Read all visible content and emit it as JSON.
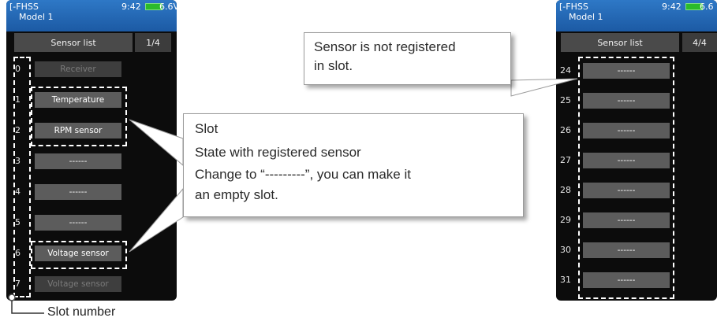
{
  "left_screen": {
    "system_label": "[-FHSS",
    "model_name": "Model 1",
    "time": "9:42",
    "voltage": "6.6V",
    "title": "Sensor list",
    "page": "1/4",
    "rows": [
      {
        "num": "0",
        "label": "Receiver",
        "dim": true
      },
      {
        "num": "1",
        "label": "Temperature",
        "dim": false
      },
      {
        "num": "2",
        "label": "RPM sensor",
        "dim": false
      },
      {
        "num": "3",
        "label": "------",
        "dim": false
      },
      {
        "num": "4",
        "label": "------",
        "dim": false
      },
      {
        "num": "5",
        "label": "------",
        "dim": false
      },
      {
        "num": "6",
        "label": "Voltage sensor",
        "dim": false
      },
      {
        "num": "7",
        "label": "Voltage sensor",
        "dim": true
      }
    ]
  },
  "right_screen": {
    "system_label": "[-FHSS",
    "model_name": "Model 1",
    "time": "9:42",
    "voltage": "6.6",
    "title": "Sensor list",
    "page": "4/4",
    "rows": [
      {
        "num": "24",
        "label": "------"
      },
      {
        "num": "25",
        "label": "------"
      },
      {
        "num": "26",
        "label": "------"
      },
      {
        "num": "27",
        "label": "------"
      },
      {
        "num": "28",
        "label": "------"
      },
      {
        "num": "29",
        "label": "------"
      },
      {
        "num": "30",
        "label": "------"
      },
      {
        "num": "31",
        "label": "------"
      }
    ]
  },
  "callouts": {
    "not_registered": {
      "line1": "Sensor is not registered",
      "line2": "in slot."
    },
    "slot": {
      "line1": "Slot",
      "line2": "State with registered sensor",
      "line3": "Change to “---------”, you can make it",
      "line4": "an empty slot."
    }
  },
  "slot_number_label": "Slot number"
}
